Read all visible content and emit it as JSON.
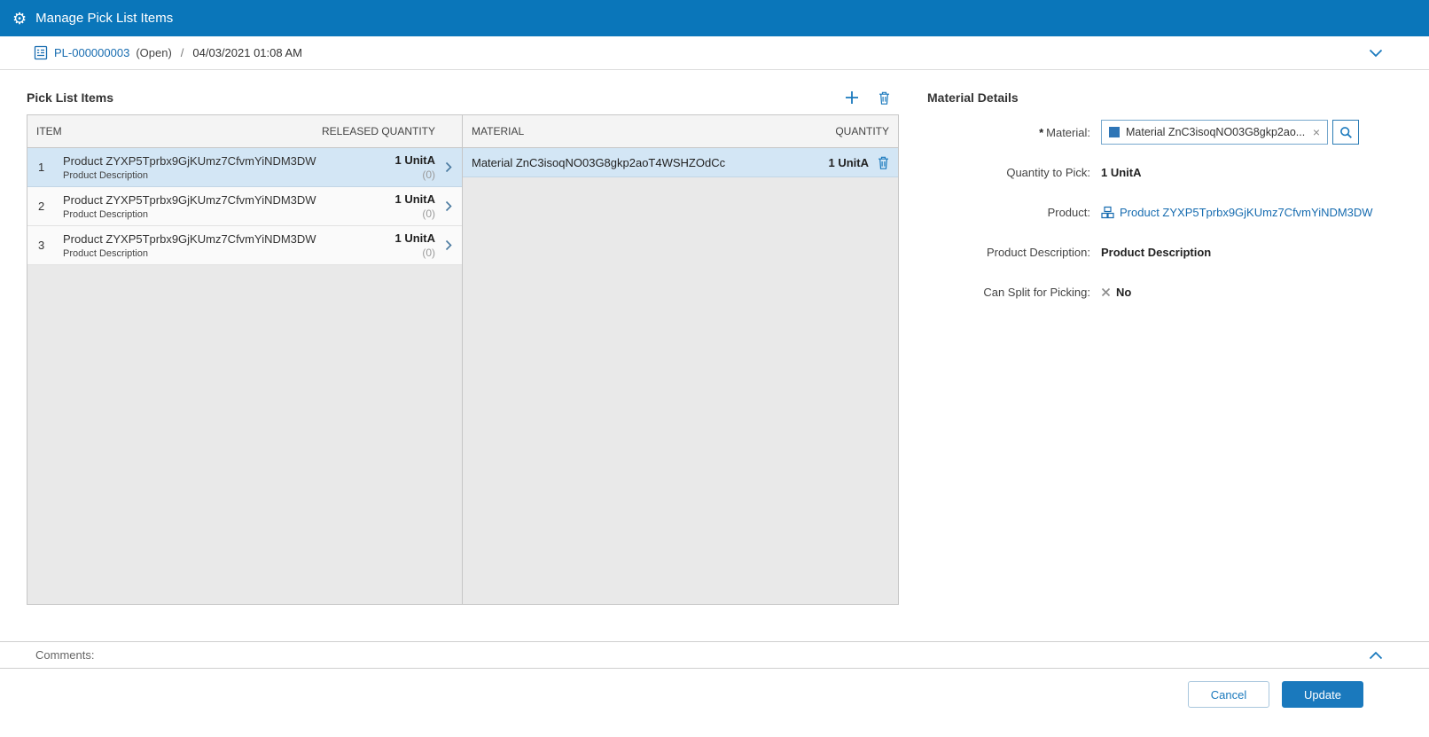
{
  "colors": {
    "header_bg": "#0a76ba",
    "accent": "#1a79bd",
    "link": "#176cb0",
    "selected_row": "#d3e6f5"
  },
  "icons": {
    "topbar": "gear-icon",
    "breadcrumb": "pick-list-doc-icon",
    "breadcrumb_right": "chevron-down-icon",
    "toolbar": [
      "plus-icon",
      "trash-icon"
    ],
    "item_rows": "chevron-right-icon",
    "material_row": "trash-icon",
    "material_field": [
      "material-swatch-icon",
      "clear-x-icon",
      "search-icon"
    ],
    "product_field": "product-icon",
    "can_split_field": "x-mark-icon",
    "comments": "chevron-up-icon"
  },
  "topbar": {
    "title": "Manage Pick List Items"
  },
  "breadcrumb": {
    "id": "PL-000000003",
    "status": "(Open)",
    "separator": "/",
    "timestamp": "04/03/2021 01:08 AM"
  },
  "pick_list": {
    "title": "Pick List Items",
    "items_table": {
      "col_item": "ITEM",
      "col_released": "RELEASED QUANTITY",
      "rows": [
        {
          "num": "1",
          "name": "Product ZYXP5Tprbx9GjKUmz7CfvmYiNDM3DW",
          "desc": "Product Description",
          "qty": "1 UnitA",
          "released": "(0)",
          "selected": true
        },
        {
          "num": "2",
          "name": "Product ZYXP5Tprbx9GjKUmz7CfvmYiNDM3DW",
          "desc": "Product Description",
          "qty": "1 UnitA",
          "released": "(0)",
          "selected": false
        },
        {
          "num": "3",
          "name": "Product ZYXP5Tprbx9GjKUmz7CfvmYiNDM3DW",
          "desc": "Product Description",
          "qty": "1 UnitA",
          "released": "(0)",
          "selected": false
        }
      ]
    },
    "materials_table": {
      "col_material": "MATERIAL",
      "col_quantity": "QUANTITY",
      "rows": [
        {
          "name": "Material ZnC3isoqNO03G8gkp2aoT4WSHZOdCc",
          "qty": "1 UnitA",
          "selected": true
        }
      ]
    }
  },
  "material_details": {
    "title": "Material Details",
    "material": {
      "required_mark": "*",
      "label": "Material:",
      "value": "Material ZnC3isoqNO03G8gkp2ao...",
      "clear": "×"
    },
    "quantity_to_pick": {
      "label": "Quantity to Pick:",
      "value": "1 UnitA"
    },
    "product": {
      "label": "Product:",
      "value": "Product ZYXP5Tprbx9GjKUmz7CfvmYiNDM3DW"
    },
    "product_description": {
      "label": "Product Description:",
      "value": "Product Description"
    },
    "can_split": {
      "label": "Can Split for Picking:",
      "value": "No"
    }
  },
  "comments": {
    "label": "Comments:"
  },
  "footer": {
    "cancel_label": "Cancel",
    "update_label": "Update"
  }
}
